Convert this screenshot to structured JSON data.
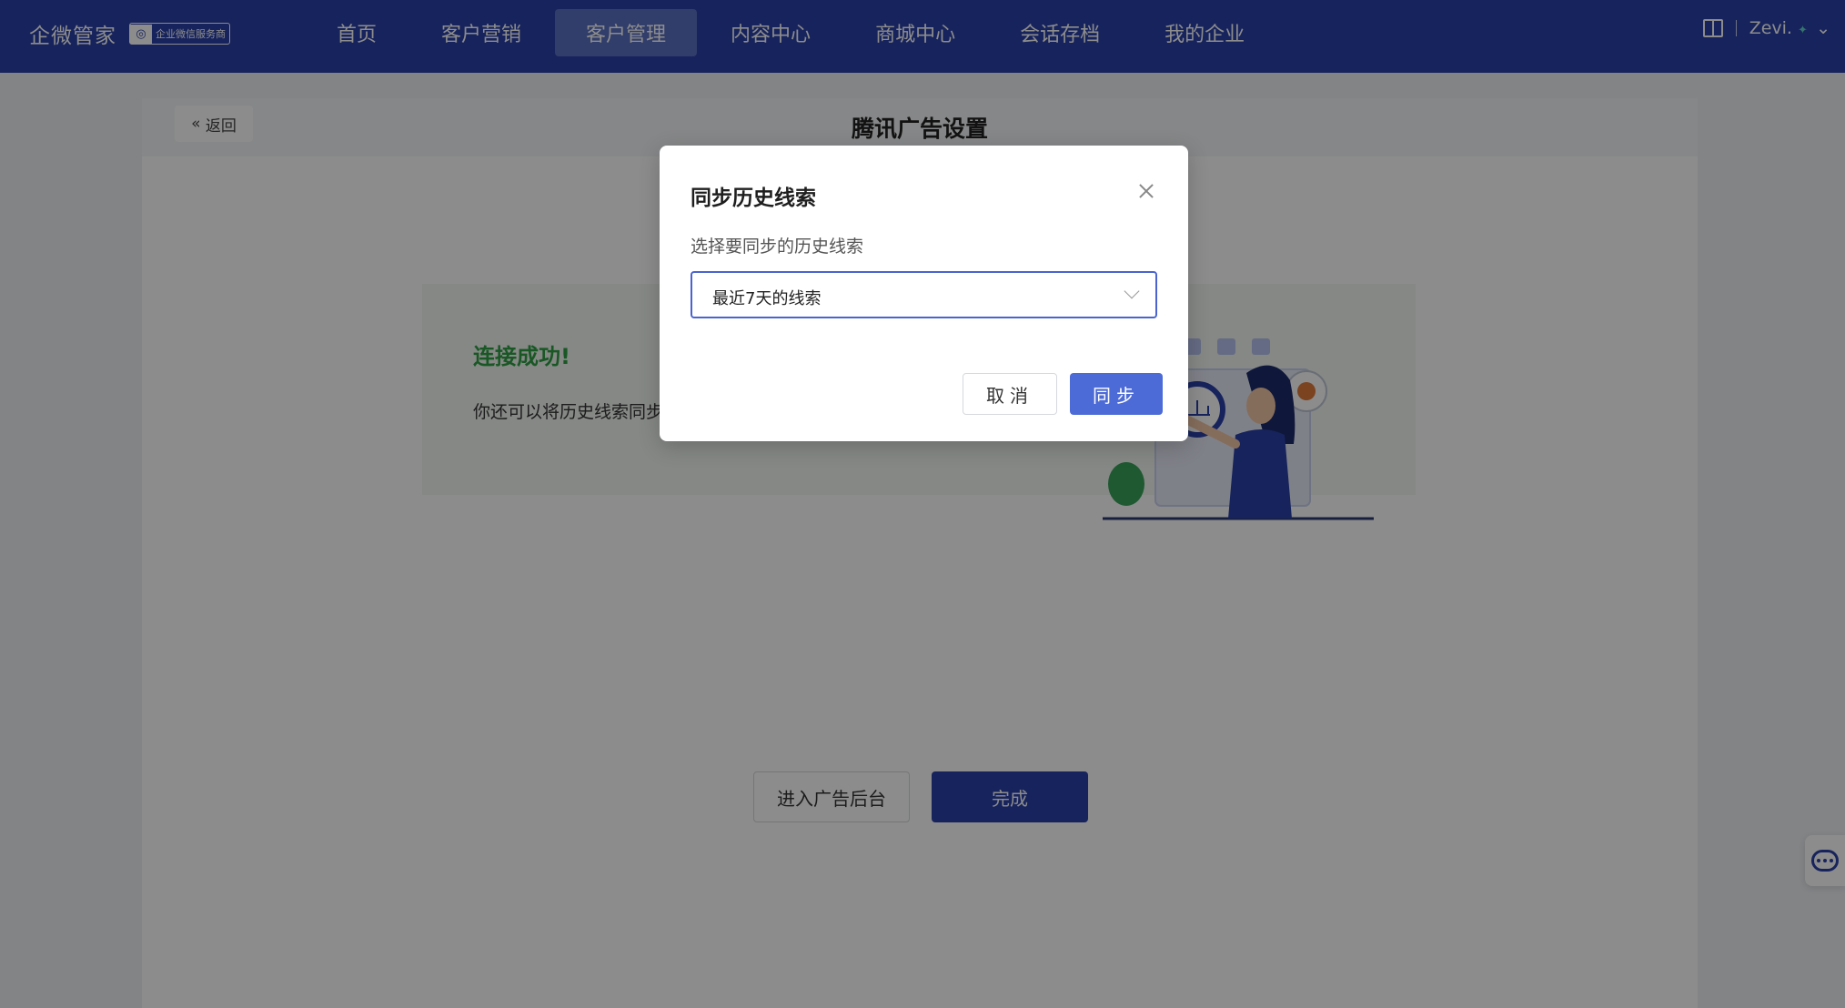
{
  "brand": {
    "name": "企微管家",
    "badge": "企业微信服务商"
  },
  "nav": {
    "items": [
      {
        "label": "首页",
        "active": false
      },
      {
        "label": "客户营销",
        "active": false
      },
      {
        "label": "客户管理",
        "active": true
      },
      {
        "label": "内容中心",
        "active": false
      },
      {
        "label": "商城中心",
        "active": false
      },
      {
        "label": "会话存档",
        "active": false
      },
      {
        "label": "我的企业",
        "active": false
      }
    ]
  },
  "user": {
    "name": "Zevi."
  },
  "page": {
    "back_label": "返回",
    "title": "腾讯广告设置",
    "success_title": "连接成功!",
    "success_desc": "你还可以将历史线索同步",
    "enter_ads_label": "进入广告后台",
    "done_label": "完成"
  },
  "modal": {
    "title": "同步历史线索",
    "label": "选择要同步的历史线索",
    "select_value": "最近7天的线索",
    "cancel_label": "取消",
    "confirm_label": "同步"
  },
  "colors": {
    "brand": "#2b40a8",
    "primary": "#4d6bd6",
    "success": "#2f9e44"
  }
}
